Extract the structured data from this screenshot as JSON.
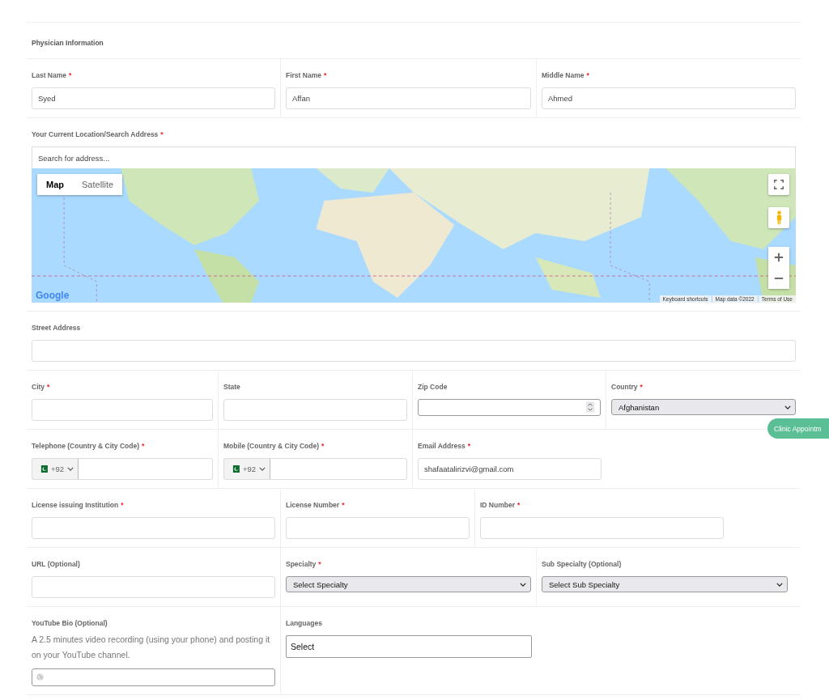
{
  "section_title": "Physician Information",
  "rows": [
    {
      "fields": [
        {
          "kind": "text",
          "label": "Last Name",
          "required_mark": "*",
          "value": "Syed"
        },
        {
          "kind": "text",
          "label": "First Name",
          "required_mark": "*",
          "value": "Affan"
        },
        {
          "kind": "text",
          "label": "Middle Name",
          "required_mark": "*",
          "value": "Ahmed"
        }
      ]
    },
    {
      "fields": [
        {
          "kind": "map",
          "label": "Your Current Location/Search Address",
          "required_mark": "*",
          "placeholder": "Search for address...",
          "map_types": [
            {
              "label": "Map",
              "selected": true
            },
            {
              "label": "Satellite",
              "selected": false
            }
          ],
          "logo": "Google",
          "attribution": [
            "Keyboard shortcuts",
            "Map data ©2022",
            "Terms of Use"
          ]
        }
      ]
    },
    {
      "fields": [
        {
          "kind": "text",
          "label": "Street Address"
        }
      ]
    },
    {
      "fields": [
        {
          "kind": "text",
          "label": "City",
          "required_mark": "*"
        },
        {
          "kind": "text",
          "label": "State"
        },
        {
          "kind": "number",
          "label": "Zip Code"
        },
        {
          "kind": "select",
          "label": "Country",
          "required_mark": "*",
          "value": "Afghanistan"
        }
      ]
    },
    {
      "fields": [
        {
          "kind": "phone",
          "label": "Telephone (Country & City Code)",
          "required_mark": "*",
          "dial_code": "+92"
        },
        {
          "kind": "phone",
          "label": "Mobile (Country & City Code)",
          "required_mark": "*",
          "dial_code": "+92"
        },
        {
          "kind": "text",
          "label": "Email Address",
          "required_mark": "*",
          "value": "shafaatalirizvi@gmail.com"
        }
      ]
    },
    {
      "fields": [
        {
          "kind": "text",
          "label": "License issuing Institution",
          "required_mark": "*"
        },
        {
          "kind": "text",
          "label": "License Number",
          "required_mark": "*"
        },
        {
          "kind": "text",
          "label": "ID Number",
          "required_mark": "*"
        }
      ]
    },
    {
      "fields": [
        {
          "kind": "text",
          "label": "URL (Optional)"
        },
        {
          "kind": "select",
          "label": "Specialty",
          "required_mark": "*",
          "value": "Select Specialty"
        },
        {
          "kind": "select",
          "label": "Sub Specialty (Optional)",
          "value": "Select Sub Specialty"
        }
      ]
    },
    {
      "fields": [
        {
          "kind": "url",
          "label": "YouTube Bio (Optional)",
          "description": "A 2.5 minutes video recording (using your phone) and posting it on your YouTube channel."
        },
        {
          "kind": "multiselect",
          "label": "Languages",
          "value": "Select"
        }
      ]
    }
  ],
  "floating_button": "Clinic Appointm"
}
